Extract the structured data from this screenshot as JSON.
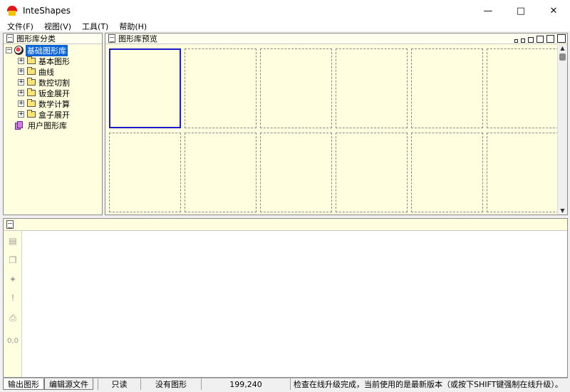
{
  "window": {
    "title": "InteShapes"
  },
  "menu": [
    "文件(F)",
    "视图(V)",
    "工具(T)",
    "帮助(H)"
  ],
  "left_panel": {
    "title": "图形库分类",
    "root": "基础图形库",
    "children": [
      "基本图形",
      "曲线",
      "数控切割",
      "钣金展开",
      "数学计算",
      "盒子展开"
    ],
    "user_lib": "用户图形库"
  },
  "preview_panel": {
    "title": "图形库预览",
    "selected_tile": 0
  },
  "bottom_panel": {
    "toolbar_icons": [
      "layers-icon",
      "copy-icon",
      "graph-icon",
      "warning-icon",
      "print-icon"
    ],
    "coords_label": "0,0"
  },
  "status": {
    "tabs": [
      "输出图形",
      "编辑源文件"
    ],
    "mode": "只读",
    "shape_status": "没有图形",
    "coords": "199,240",
    "message": "检查在线升级完成，当前使用的是最新版本（或按下SHIFT键强制在线升级）。"
  }
}
